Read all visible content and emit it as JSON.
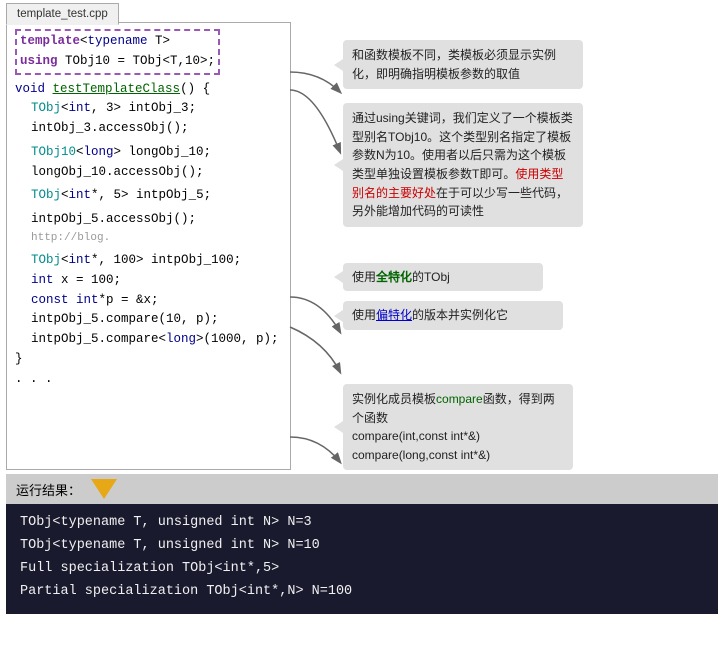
{
  "tab": {
    "label": "template_test.cpp"
  },
  "code": {
    "lines": [
      {
        "type": "template_decl",
        "text": "template<typename T>"
      },
      {
        "type": "using_decl",
        "text": "using TObj10 = TObj<T,10>;"
      },
      {
        "type": "blank"
      },
      {
        "type": "void_decl",
        "text": "void testTemplateClass() {"
      },
      {
        "type": "indent1",
        "text": "    TObj<int, 3> intObj_3;"
      },
      {
        "type": "indent1",
        "text": "    intObj_3.accessObj();"
      },
      {
        "type": "blank"
      },
      {
        "type": "indent1",
        "text": "    TObj10<long> longObj_10;"
      },
      {
        "type": "indent1",
        "text": "    longObj_10.accessObj();"
      },
      {
        "type": "blank"
      },
      {
        "type": "indent1",
        "text": "    TObj<int*, 5> intpObj_5;"
      },
      {
        "type": "blank"
      },
      {
        "type": "indent1",
        "text": "    intpObj_5.accessObj();"
      },
      {
        "type": "comment",
        "text": "                    http://blog."
      },
      {
        "type": "blank"
      },
      {
        "type": "indent1",
        "text": "    TObj<int*, 100> intpObj_100;"
      },
      {
        "type": "indent1",
        "text": "    int x = 100;"
      },
      {
        "type": "indent1",
        "text": "    const int*p = &x;"
      },
      {
        "type": "indent1",
        "text": "    intpObj_5.compare(10, p);"
      },
      {
        "type": "indent1",
        "text": "    intpObj_5.compare<long>(1000, p);"
      },
      {
        "type": "brace",
        "text": "}"
      },
      {
        "type": "dots",
        "text": "..."
      }
    ]
  },
  "annotations": [
    {
      "id": "ann1",
      "text": "和函数模板不同，类模板必须显示实例化，即明确指明模板参数的取值"
    },
    {
      "id": "ann2",
      "text_parts": [
        {
          "text": "通过using关键词，我们定义了一个模板类型别名TObj10。这个类型别名指定了模板参数N为10。使用者以后只需为这个模板类型单独设置模板参数T即可。"
        },
        {
          "text": "使用类型别名的主要好处",
          "style": "red"
        },
        {
          "text": "在于可以少写一些代码，另外能增加代码的可读性"
        }
      ]
    },
    {
      "id": "ann3",
      "text_parts": [
        {
          "text": "使用"
        },
        {
          "text": "全特化",
          "style": "bold-green"
        },
        {
          "text": "的TObj"
        }
      ]
    },
    {
      "id": "ann4",
      "text_parts": [
        {
          "text": "使用"
        },
        {
          "text": "偏特化",
          "style": "underline-blue"
        },
        {
          "text": "的版本并实例化它"
        }
      ]
    },
    {
      "id": "ann5",
      "text_parts": [
        {
          "text": "实例化成员模板"
        },
        {
          "text": "compare",
          "style": "green"
        },
        {
          "text": "函数，得到两个函数"
        },
        {
          "text": "\ncompare(int,const int*&)\ncompare(long,const int*&)"
        }
      ]
    }
  ],
  "run_bar": {
    "label": "运行结果：",
    "arrow": "↓"
  },
  "output": {
    "lines": [
      "TObj<typename T, unsigned int N> N=3",
      "TObj<typename T, unsigned int N> N=10",
      "Full specialization TObj<int*,5>",
      "Partial specialization TObj<int*,N> N=100"
    ]
  }
}
